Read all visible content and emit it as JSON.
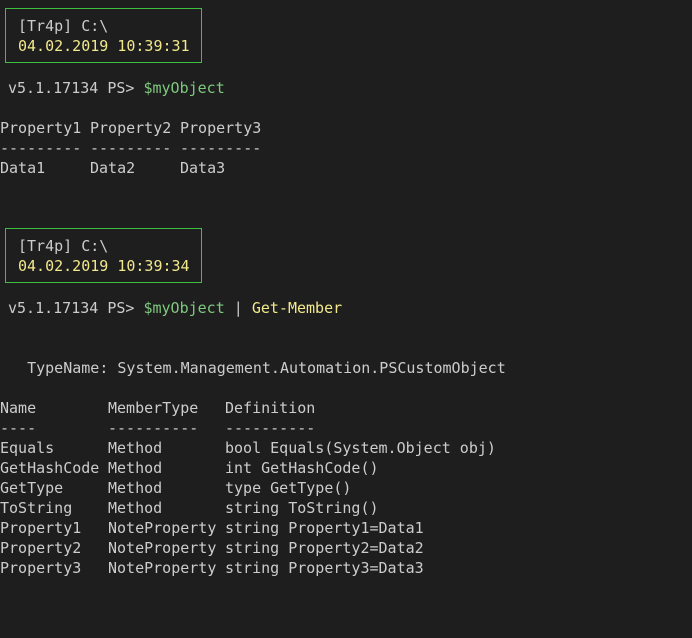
{
  "prompt_block_1": {
    "user_path": "[Tr4p] C:\\",
    "timestamp": "04.02.2019 10:39:31"
  },
  "command_1": {
    "ps_prefix": "v5.1.17134 PS> ",
    "variable": "$myObject"
  },
  "table_1": {
    "headers": [
      "Property1",
      "Property2",
      "Property3"
    ],
    "separators": [
      "---------",
      "---------",
      "---------"
    ],
    "row": [
      "Data1",
      "Data2",
      "Data3"
    ]
  },
  "prompt_block_2": {
    "user_path": "[Tr4p] C:\\",
    "timestamp": "04.02.2019 10:39:34"
  },
  "command_2": {
    "ps_prefix": "v5.1.17134 PS> ",
    "variable": "$myObject",
    "pipe": " | ",
    "cmdlet": "Get-Member"
  },
  "typename_line": "   TypeName: System.Management.Automation.PSCustomObject",
  "member_table": {
    "headers": [
      "Name",
      "MemberType",
      "Definition"
    ],
    "separators": [
      "----",
      "----------",
      "----------"
    ],
    "rows": [
      [
        "Equals",
        "Method",
        "bool Equals(System.Object obj)"
      ],
      [
        "GetHashCode",
        "Method",
        "int GetHashCode()"
      ],
      [
        "GetType",
        "Method",
        "type GetType()"
      ],
      [
        "ToString",
        "Method",
        "string ToString()"
      ],
      [
        "Property1",
        "NoteProperty",
        "string Property1=Data1"
      ],
      [
        "Property2",
        "NoteProperty",
        "string Property2=Data2"
      ],
      [
        "Property3",
        "NoteProperty",
        "string Property3=Data3"
      ]
    ]
  }
}
